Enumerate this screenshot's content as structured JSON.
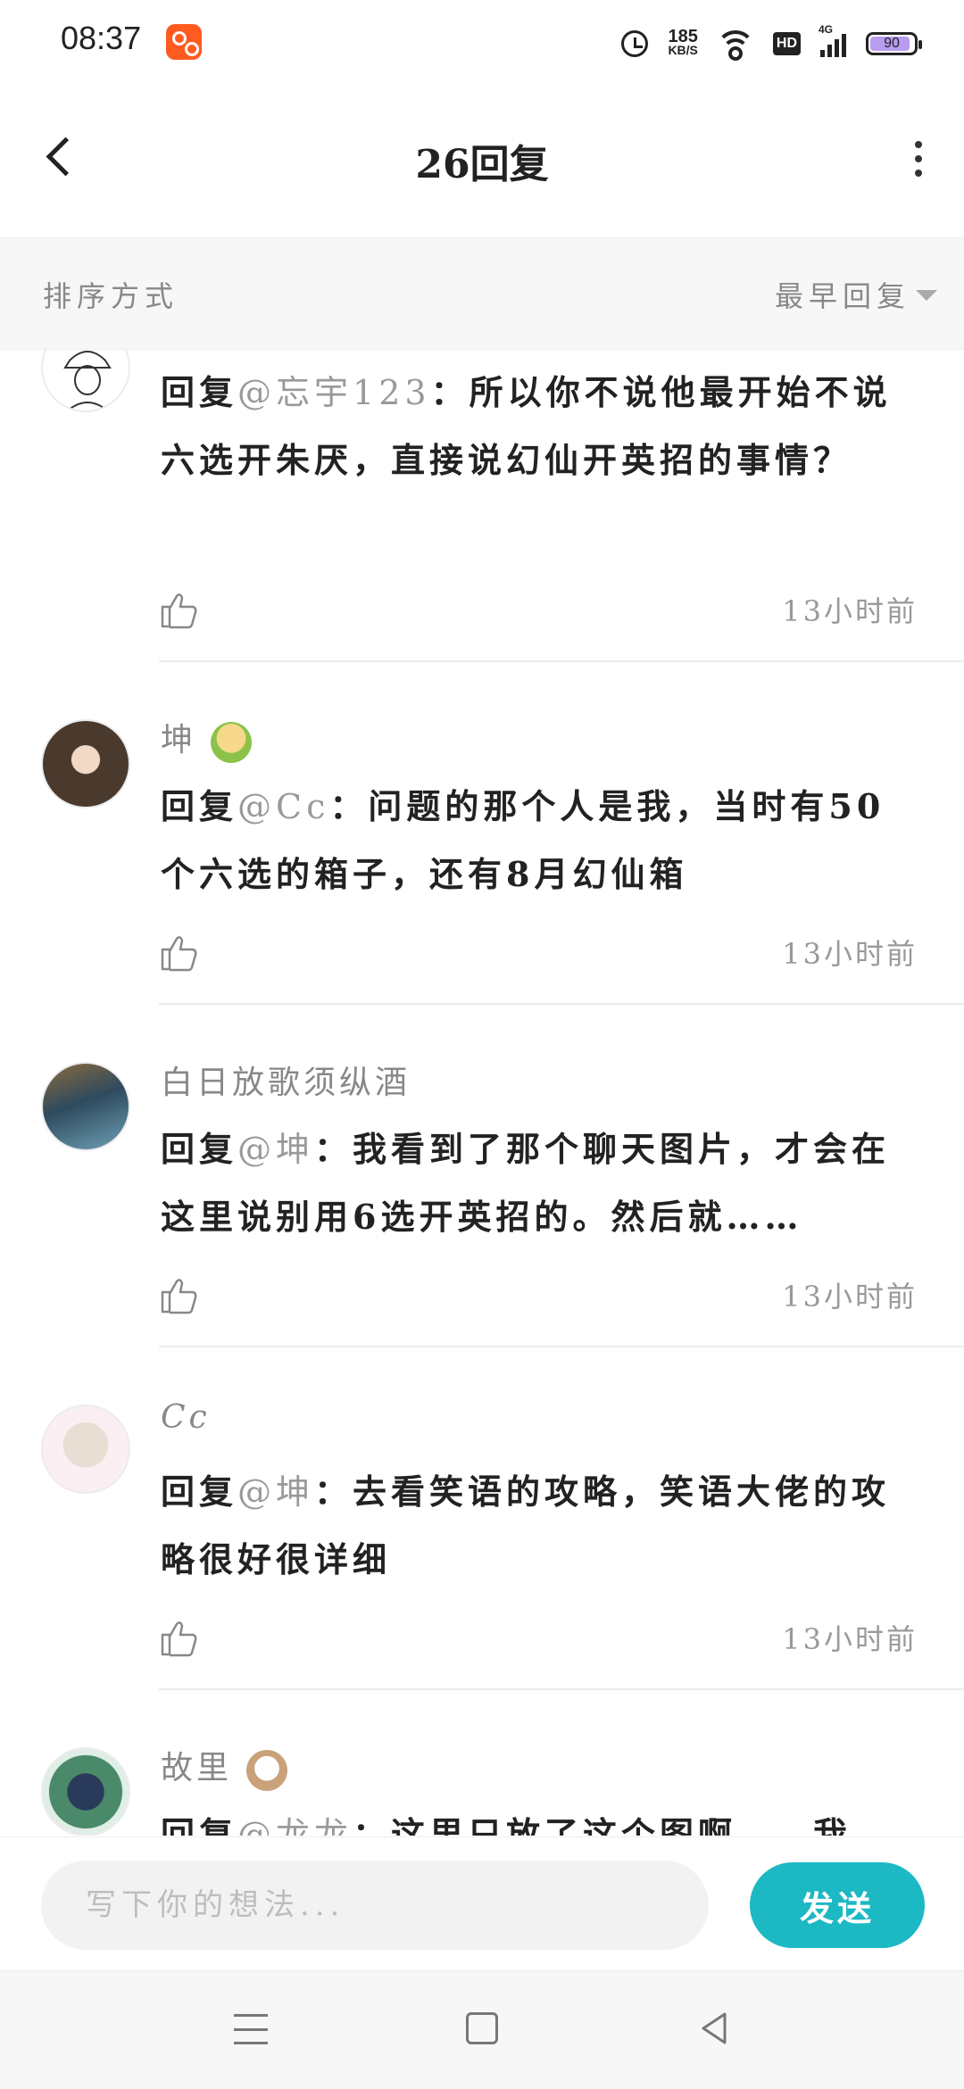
{
  "status_bar": {
    "time": "08:37",
    "net_speed_value": "185",
    "net_speed_unit": "KB/S",
    "hd_label": "HD",
    "signal_label": "4G",
    "battery_level": "90"
  },
  "header": {
    "title": "26回复"
  },
  "sort": {
    "label": "排序方式",
    "value": "最早回复"
  },
  "comments": [
    {
      "user": "",
      "reply_prefix": "回复",
      "mention": "@忘宇123",
      "separator": "：",
      "text": "所以你不说他最开始不说六选开朱厌，直接说幻仙开英招的事情？",
      "time": "13小时前"
    },
    {
      "user": "坤",
      "reply_prefix": "回复",
      "mention": "@Cc",
      "separator": "：",
      "text": "问题的那个人是我，当时有50个六选的箱子，还有8月幻仙箱",
      "time": "13小时前"
    },
    {
      "user": "白日放歌须纵酒",
      "reply_prefix": "回复",
      "mention": "@坤",
      "separator": "：",
      "text": "我看到了那个聊天图片，才会在这里说别用6选开英招的。然后就……",
      "time": "13小时前"
    },
    {
      "user": "Cc",
      "reply_prefix": "回复",
      "mention": "@坤",
      "separator": "：",
      "text": "去看笑语的攻略，笑语大佬的攻略很好很详细",
      "time": "13小时前"
    },
    {
      "user": "故里",
      "reply_prefix": "回复",
      "mention": "@龙龙",
      "separator": "：",
      "text": "这里只放了这个图啊……我",
      "time": ""
    }
  ],
  "compose": {
    "placeholder": "写下你的想法...",
    "send_label": "发送"
  },
  "colors": {
    "accent": "#1cb8c4",
    "muted_text": "#888888",
    "main_text": "#222222"
  }
}
